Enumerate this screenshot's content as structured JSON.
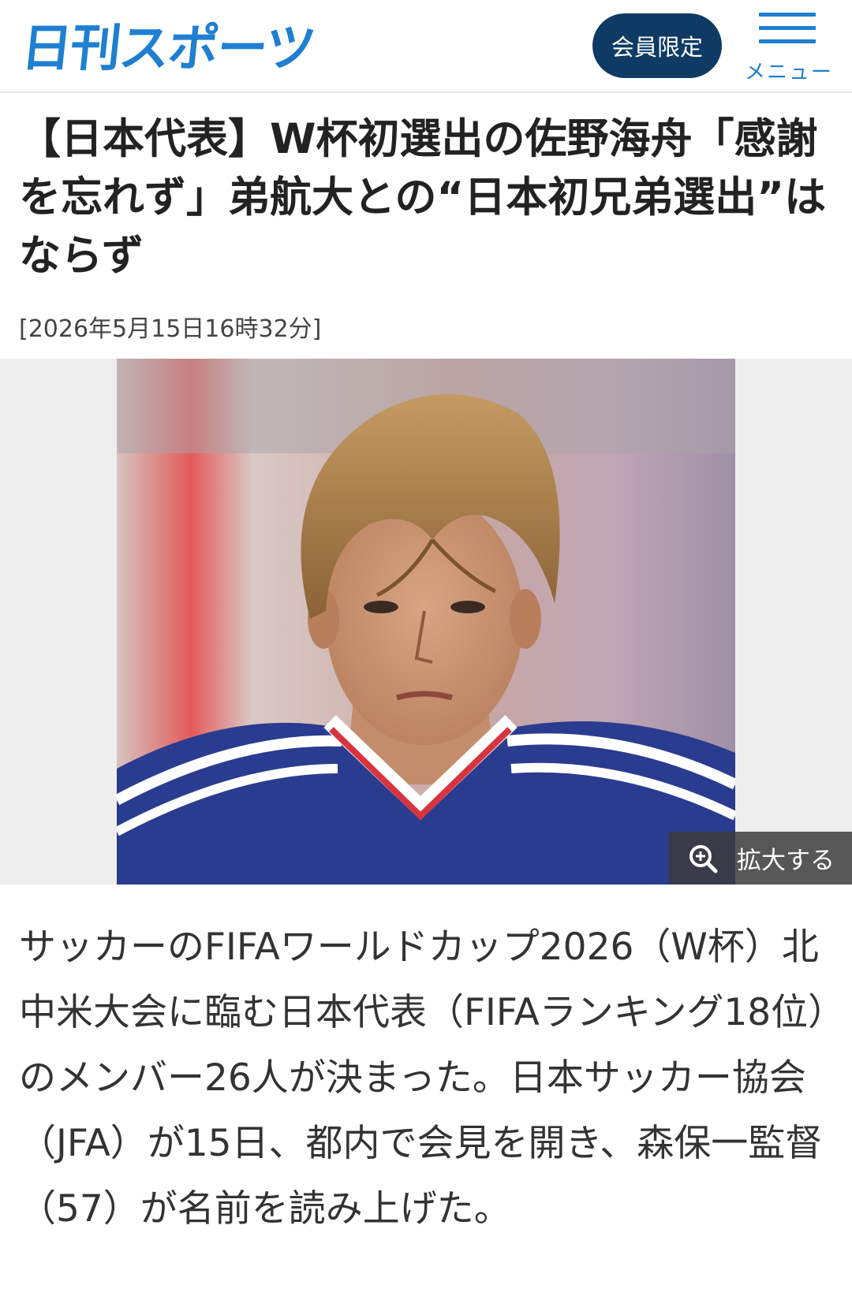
{
  "header": {
    "logo_text": "日刊スポーツ",
    "brand_color": "#1f7fd0",
    "member_label": "会員限定",
    "member_color": "#0e3a63",
    "menu_label": "メニュー",
    "menu_icon": "hamburger-icon"
  },
  "article": {
    "title": "【日本代表】W杯初選出の佐野海舟「感謝を忘れず」弟航大との“日本初兄弟選出”はならず",
    "timestamp": "[2026年5月15日16時32分]",
    "photo": {
      "zoom_label": "拡大する",
      "zoom_icon": "zoom-in-icon"
    },
    "body": "サッカーのFIFAワールドカップ2026（W杯）北中米大会に臨む日本代表（FIFAランキング18位）のメンバー26人が決まった。日本サッカー協会（JFA）が15日、都内で会見を開き、森保一監督（57）が名前を読み上げた。"
  }
}
